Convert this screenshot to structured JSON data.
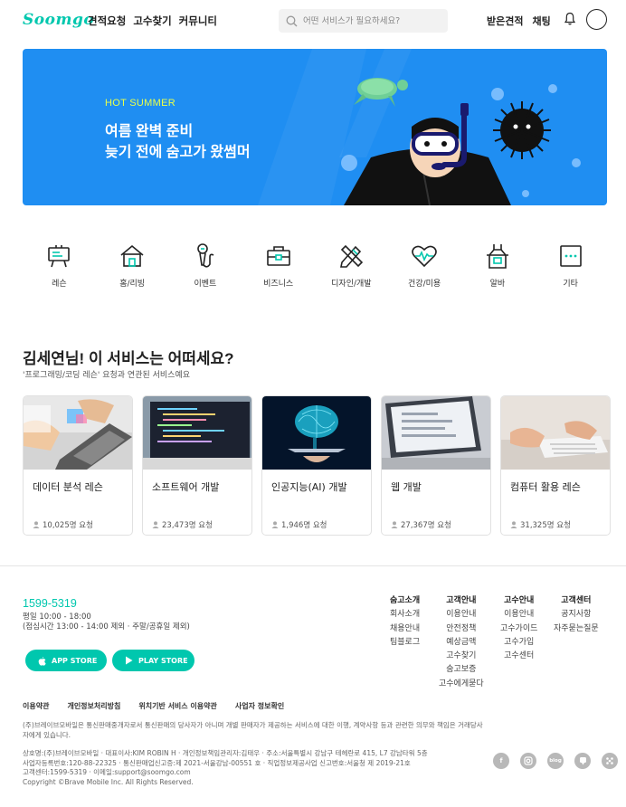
{
  "header": {
    "logo": "Soomgo",
    "nav": [
      "견적요청",
      "고수찾기",
      "커뮤니티"
    ],
    "search_placeholder": "어떤 서비스가 필요하세요?",
    "right": [
      "받은견적",
      "채팅"
    ]
  },
  "banner": {
    "kicker": "HOT SUMMER",
    "line1": "여름 완벽 준비",
    "line2": "늦기 전에 숨고가 왔썸머",
    "bg_color": "#1f8ef2",
    "kicker_color": "#e9ff4a"
  },
  "categories": [
    {
      "label": "레슨",
      "icon": "whiteboard-icon"
    },
    {
      "label": "홈/리빙",
      "icon": "house-icon"
    },
    {
      "label": "이벤트",
      "icon": "microphone-icon"
    },
    {
      "label": "비즈니스",
      "icon": "briefcase-icon"
    },
    {
      "label": "디자인/개발",
      "icon": "pencil-ruler-icon"
    },
    {
      "label": "건강/미용",
      "icon": "heart-pulse-icon"
    },
    {
      "label": "알바",
      "icon": "apron-icon"
    },
    {
      "label": "기타",
      "icon": "more-icon"
    }
  ],
  "recommend": {
    "title": "김세연님! 이 서비스는 어떠세요?",
    "subtitle": "'프로그래밍/코딩 레슨' 요청과 연관된 서비스예요",
    "cards": [
      {
        "name": "데이터 분석 레슨",
        "requests": "10,025명 요청"
      },
      {
        "name": "소프트웨어 개발",
        "requests": "23,473명 요청"
      },
      {
        "name": "인공지능(AI) 개발",
        "requests": "1,946명 요청"
      },
      {
        "name": "웹 개발",
        "requests": "27,367명 요청"
      },
      {
        "name": "컴퓨터 활용 레슨",
        "requests": "31,325명 요청"
      }
    ]
  },
  "footer": {
    "phone": "1599-5319",
    "hours1": "평일 10:00 - 18:00",
    "hours2": "(점심시간 13:00 - 14:00 제외 · 주말/공휴일 제외)",
    "app_store": "APP STORE",
    "play_store": "PLAY STORE",
    "columns": [
      {
        "title": "숨고소개",
        "items": [
          "회사소개",
          "채용안내",
          "팀블로그"
        ]
      },
      {
        "title": "고객안내",
        "items": [
          "이용안내",
          "안전정책",
          "예상금액",
          "고수찾기",
          "숨고보증",
          "고수에게묻다"
        ]
      },
      {
        "title": "고수안내",
        "items": [
          "이용안내",
          "고수가이드",
          "고수가입",
          "고수센터"
        ]
      },
      {
        "title": "고객센터",
        "items": [
          "공지사항",
          "자주묻는질문"
        ]
      }
    ],
    "links": [
      "이용약관",
      "개인정보처리방침",
      "위치기반 서비스 이용약관",
      "사업자 정보확인"
    ],
    "legal": "(주)브레이브모바일은 통신판매중개자로서 통신판매의 당사자가 아니며 개별 판매자가 제공하는 서비스에 대한 이행, 계약사항 등과 관련한 의무와 책임은 거래당사자에게 있습니다.",
    "biz1": "상호명:(주)브레이브모바일 · 대표이사:KIM ROBIN H · 개인정보책임관리자:김태우 · 주소:서울특별시 강남구 테헤란로 415, L7 강남타워 5층",
    "biz2": "사업자등록번호:120-88-22325 · 통신판매업신고증:제 2021-서울강남-00551 호 · 직업정보제공사업 신고번호:서울청 제 2019-21호",
    "biz3": "고객센터:1599-5319 · 이메일:support@soomgo.com",
    "copyright": "Copyright ©Brave Mobile Inc. All Rights Reserved.",
    "social": [
      "facebook-icon",
      "instagram-icon",
      "blog-icon",
      "post-icon",
      "app-icon"
    ],
    "accent": "#00c7ae"
  }
}
